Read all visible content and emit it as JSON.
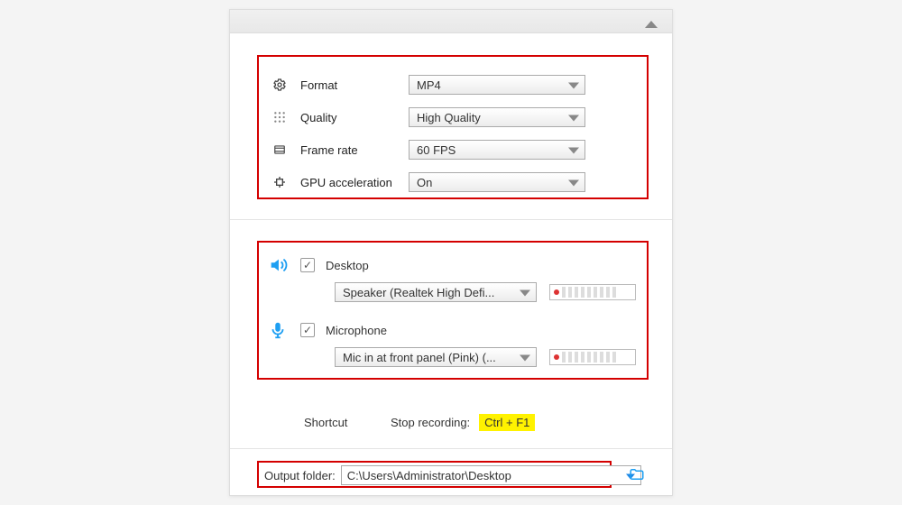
{
  "video": {
    "format_label": "Format",
    "format_value": "MP4",
    "quality_label": "Quality",
    "quality_value": "High Quality",
    "framerate_label": "Frame rate",
    "framerate_value": "60 FPS",
    "gpu_label": "GPU acceleration",
    "gpu_value": "On"
  },
  "audio": {
    "desktop_label": "Desktop",
    "desktop_device": "Speaker (Realtek High Defi...",
    "mic_label": "Microphone",
    "mic_device": "Mic in at front panel (Pink) (..."
  },
  "shortcut": {
    "label": "Shortcut",
    "action": "Stop recording:",
    "key": "Ctrl + F1"
  },
  "output": {
    "label": "Output folder:",
    "path": "C:\\Users\\Administrator\\Desktop"
  }
}
